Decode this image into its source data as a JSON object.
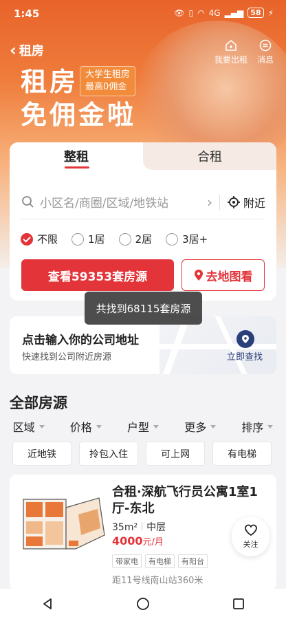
{
  "status_bar": {
    "time": "1:45",
    "network": "4G",
    "battery": "58"
  },
  "nav": {
    "back_label": "租房",
    "publish_label": "我要出租",
    "message_label": "消息"
  },
  "hero": {
    "title_line1": "租房",
    "title_line2": "免佣金啦",
    "badge_line1": "大学生租房",
    "badge_line2": "最高0佣金"
  },
  "tabs": [
    {
      "label": "整租",
      "active": true
    },
    {
      "label": "合租",
      "active": false
    }
  ],
  "search": {
    "placeholder": "小区名/商圈/区域/地铁站",
    "nearby_label": "附近"
  },
  "room_options": [
    {
      "label": "不限",
      "checked": true
    },
    {
      "label": "1居",
      "checked": false
    },
    {
      "label": "2居",
      "checked": false
    },
    {
      "label": "3居+",
      "checked": false
    }
  ],
  "buttons": {
    "view_listings": "查看59353套房源",
    "map_search": "去地图看"
  },
  "toast": "共找到68115套房源",
  "company": {
    "title": "点击输入你的公司地址",
    "subtitle": "快速找到公司附近房源",
    "link": "立即查找"
  },
  "section_title": "全部房源",
  "filters": [
    "区域",
    "价格",
    "户型",
    "更多",
    "排序"
  ],
  "quick_tags": [
    "近地铁",
    "拎包入住",
    "可上网",
    "有电梯"
  ],
  "listing": {
    "title": "合租·深航飞行员公寓1室1厅-东北",
    "area": "35m²",
    "floor": "中层",
    "price": "4000",
    "price_unit": "元/月",
    "tags": [
      "带家电",
      "有电梯",
      "有阳台"
    ],
    "distance": "距11号线南山站360米",
    "follow_label": "关注"
  },
  "colors": {
    "accent": "#e3343a",
    "hero_orange": "#e8632a",
    "map_blue": "#2b3f7a"
  }
}
